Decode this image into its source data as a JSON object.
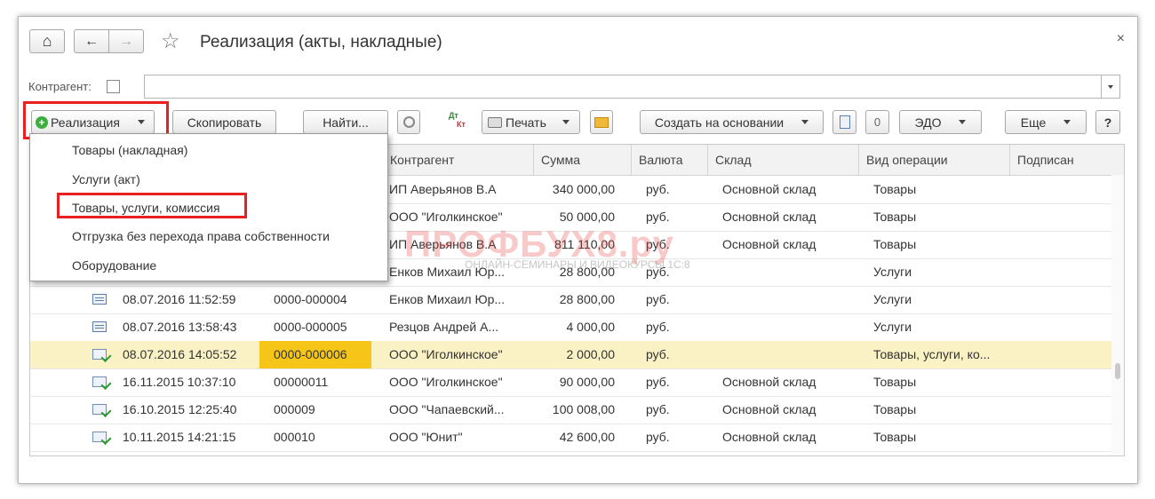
{
  "window": {
    "title": "Реализация (акты, накладные)",
    "close_glyph": "×"
  },
  "nav": {
    "home_glyph": "⌂",
    "back_glyph": "←",
    "forward_glyph": "→",
    "star_glyph": "☆"
  },
  "filter": {
    "label": "Контрагент:",
    "value": ""
  },
  "toolbar": {
    "create_label": "Реализация",
    "copy_label": "Скопировать",
    "find_label": "Найти...",
    "dt_label": "Дт",
    "kt_label": "Кт",
    "print_label": "Печать",
    "based_on_label": "Создать на основании",
    "edo_label": "ЭДО",
    "more_label": "Еще",
    "help_label": "?",
    "clip_glyph": "0"
  },
  "dropdown_menu": {
    "items": [
      "Товары (накладная)",
      "Услуги (акт)",
      "Товары, услуги, комиссия",
      "Отгрузка без перехода права собственности",
      "Оборудование"
    ],
    "highlighted_index": 2
  },
  "table": {
    "columns": [
      "Контрагент",
      "Сумма",
      "Валюта",
      "Склад",
      "Вид операции",
      "Подписан"
    ],
    "rows": [
      {
        "icon": "doc-posted",
        "date": "",
        "number": "",
        "contractor": "ИП Аверьянов В.А",
        "sum": "340 000,00",
        "currency": "руб.",
        "warehouse": "Основной склад",
        "operation": "Товары",
        "signed": ""
      },
      {
        "icon": "doc-posted",
        "date": "",
        "number": "",
        "contractor": "ООО \"Иголкинское\"",
        "sum": "50 000,00",
        "currency": "руб.",
        "warehouse": "Основной склад",
        "operation": "Товары",
        "signed": ""
      },
      {
        "icon": "doc-posted",
        "date": "",
        "number": "",
        "contractor": "ИП Аверьянов В.А",
        "sum": "811 110,00",
        "currency": "руб.",
        "warehouse": "Основной склад",
        "operation": "Товары",
        "signed": ""
      },
      {
        "icon": "doc-posted",
        "date": "",
        "number": "",
        "contractor": "Енков Михаил Юр...",
        "sum": "28 800,00",
        "currency": "руб.",
        "warehouse": "",
        "operation": "Услуги",
        "signed": ""
      },
      {
        "icon": "doc",
        "date": "08.07.2016 11:52:59",
        "number": "0000-000004",
        "contractor": "Енков Михаил Юр...",
        "sum": "28 800,00",
        "currency": "руб.",
        "warehouse": "",
        "operation": "Услуги",
        "signed": ""
      },
      {
        "icon": "doc",
        "date": "08.07.2016 13:58:43",
        "number": "0000-000005",
        "contractor": "Резцов  Андрей А...",
        "sum": "4 000,00",
        "currency": "руб.",
        "warehouse": "",
        "operation": "Услуги",
        "signed": ""
      },
      {
        "icon": "doc-posted",
        "date": "08.07.2016 14:05:52",
        "number": "0000-000006",
        "contractor": "ООО \"Иголкинское\"",
        "sum": "2 000,00",
        "currency": "руб.",
        "warehouse": "",
        "operation": "Товары, услуги, ко...",
        "signed": "",
        "selected": true
      },
      {
        "icon": "doc-posted",
        "date": "16.11.2015 10:37:10",
        "number": "00000011",
        "contractor": "ООО \"Иголкинское\"",
        "sum": "90 000,00",
        "currency": "руб.",
        "warehouse": "Основной склад",
        "operation": "Товары",
        "signed": ""
      },
      {
        "icon": "doc-posted",
        "date": "16.10.2015 12:25:40",
        "number": "000009",
        "contractor": "ООО \"Чапаевский...",
        "sum": "100 008,00",
        "currency": "руб.",
        "warehouse": "Основной склад",
        "operation": "Товары",
        "signed": ""
      },
      {
        "icon": "doc-posted",
        "date": "10.11.2015 14:21:15",
        "number": "000010",
        "contractor": "ООО \"Юнит\"",
        "sum": "42 600,00",
        "currency": "руб.",
        "warehouse": "Основной склад",
        "operation": "Товары",
        "signed": ""
      }
    ]
  },
  "watermark": {
    "main": "ПРОФБУХ8.ру",
    "sub": "ОНЛАЙН-СЕМИНАРЫ И ВИДЕОКУРСЫ 1С:8"
  },
  "colors": {
    "highlight_red": "#e8201f",
    "selected_row": "#faf1c4",
    "selected_cell": "#f5c518"
  }
}
